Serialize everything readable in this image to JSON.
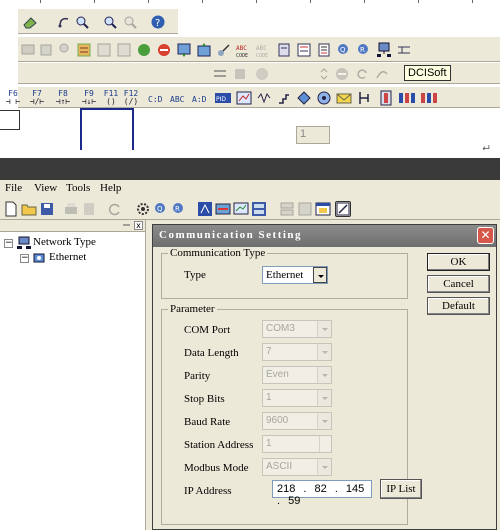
{
  "top_software": {
    "tooltip": "DCISoft",
    "number_box": "1",
    "function_keys": [
      {
        "top": "F6",
        "bottom": ""
      },
      {
        "top": "F7",
        "bottom": ""
      },
      {
        "top": "F8",
        "bottom": ""
      },
      {
        "top": "F9",
        "bottom": ""
      },
      {
        "top": "F11",
        "bottom": ""
      },
      {
        "top": "F12",
        "bottom": ""
      }
    ],
    "return_mark": "↵"
  },
  "menubar": {
    "file": "File",
    "view": "View",
    "tools": "Tools",
    "help": "Help"
  },
  "tree": {
    "root": "Network Type",
    "child": "Ethernet",
    "close_glyph": "x",
    "expand_glyph": "−"
  },
  "dialog": {
    "title": "Communication Setting",
    "close_glyph": "✕",
    "comm_type_legend": "Communication Type",
    "type_label": "Type",
    "type_value": "Ethernet",
    "parameter_legend": "Parameter",
    "fields": [
      {
        "label": "COM Port",
        "value": "COM3",
        "kind": "combo"
      },
      {
        "label": "Data Length",
        "value": "7",
        "kind": "combo"
      },
      {
        "label": "Parity",
        "value": "Even",
        "kind": "combo"
      },
      {
        "label": "Stop Bits",
        "value": "1",
        "kind": "combo"
      },
      {
        "label": "Baud Rate",
        "value": "9600",
        "kind": "combo"
      },
      {
        "label": "Station Address",
        "value": "1",
        "kind": "spin"
      },
      {
        "label": "Modbus Mode",
        "value": "ASCII",
        "kind": "combo"
      }
    ],
    "ip_label": "IP Address",
    "ip_value": "218 . 82 . 145 . 59",
    "ip_list_button": "IP List",
    "ok_button": "OK",
    "cancel_button": "Cancel",
    "default_button": "Default"
  }
}
